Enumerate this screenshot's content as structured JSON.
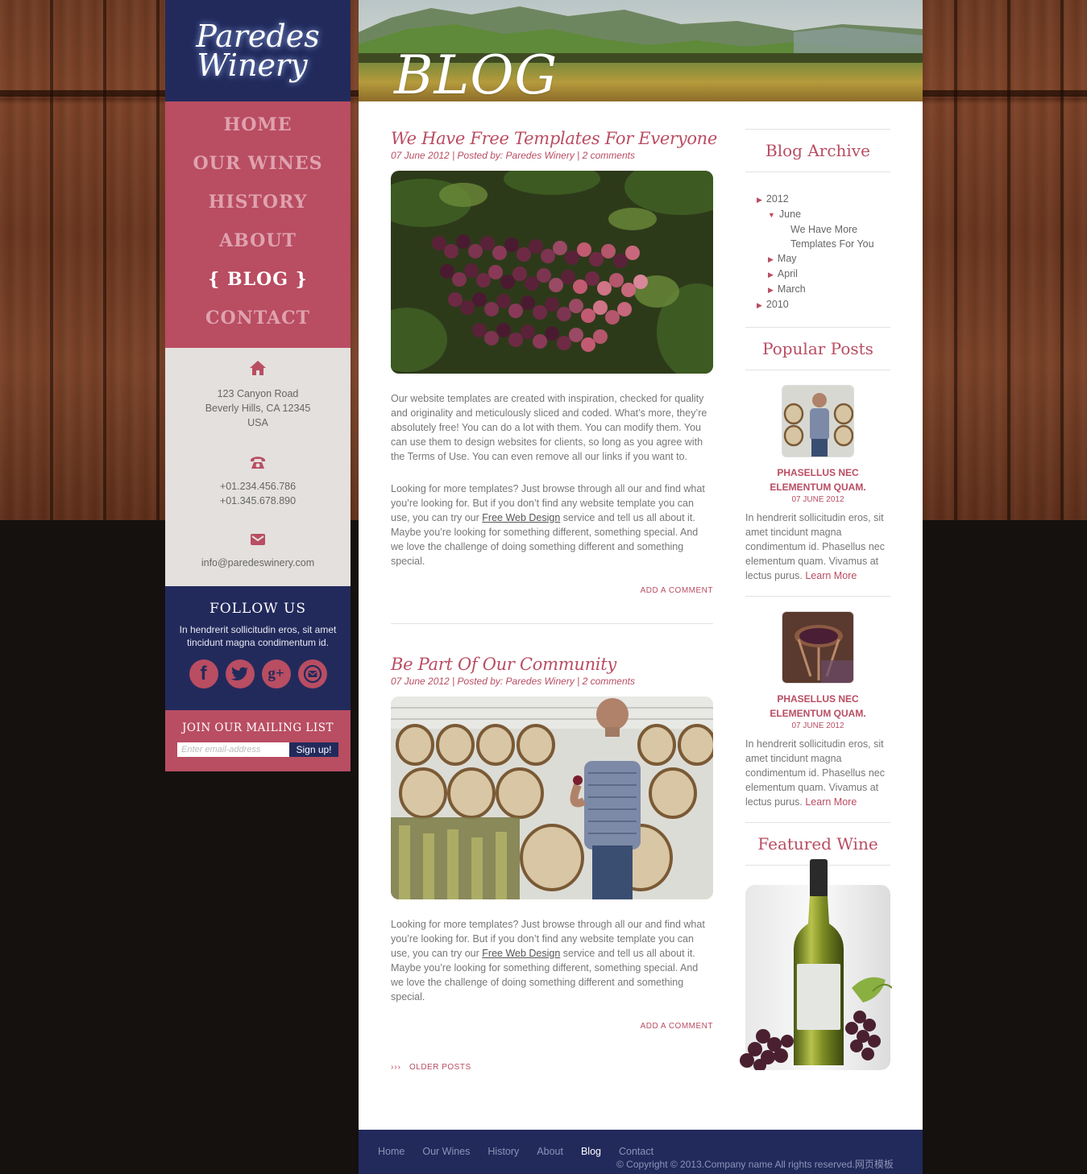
{
  "brand": {
    "line1": "Paredes",
    "line2": "Winery"
  },
  "nav": [
    {
      "label": "HOME"
    },
    {
      "label": "OUR WINES"
    },
    {
      "label": "HISTORY"
    },
    {
      "label": "ABOUT"
    },
    {
      "label": "{ BLOG }"
    },
    {
      "label": "CONTACT"
    }
  ],
  "contact": {
    "address_line1": "123 Canyon Road",
    "address_line2": "Beverly Hills, CA 12345",
    "address_line3": "USA",
    "phone1": "+01.234.456.786",
    "phone2": "+01.345.678.890",
    "email": "info@paredeswinery.com"
  },
  "follow": {
    "title": "FOLLOW US",
    "text": "In hendrerit sollicitudin eros, sit amet tincidunt magna condimentum id.",
    "icons": [
      "facebook-icon",
      "twitter-icon",
      "google-plus-icon",
      "mail-icon"
    ]
  },
  "mailing": {
    "title": "JOIN OUR MAILING LIST",
    "placeholder": "Enter email-address",
    "button": "Sign up!"
  },
  "banner": {
    "title": "BLOG"
  },
  "posts": [
    {
      "title": "We Have Free Templates For Everyone",
      "meta": "07 June 2012 | Posted by: Paredes Winery | 2 comments",
      "para1": "Our website templates are created with inspiration, checked for quality and originality and meticulously sliced and coded. What’s more, they’re absolutely free! You can do a lot with them. You can modify them. You can use them to design websites for clients, so long as you agree with the Terms of Use. You can even remove all our links if you want to.",
      "para2_a": "Looking for more templates? Just browse through all our and find what you’re looking for. But if you don’t find any website template you can use, you can try our ",
      "para2_link": "Free Web Design",
      "para2_b": " service and tell us all about it. Maybe you’re looking for something different, something special. And we love the challenge of doing something different and something special.",
      "add_comment": "ADD A COMMENT"
    },
    {
      "title": "Be Part Of Our Community",
      "meta": "07 June 2012 | Posted by: Paredes Winery | 2 comments",
      "para1_a": "Looking for more templates? Just browse through all our and find what you’re looking for. But if you don’t find any website template you can use, you can try our ",
      "para1_link": "Free Web Design",
      "para1_b": " service and tell us all about it. Maybe you’re looking for something different, something special. And we love the challenge of doing something different and something special.",
      "add_comment": "ADD A COMMENT"
    }
  ],
  "older_posts": {
    "arrows": "›››",
    "label": "OLDER POSTS"
  },
  "archive": {
    "title": "Blog Archive",
    "y2012": "2012",
    "june": "June",
    "june_post1": "We Have More",
    "june_post2": "Templates For You",
    "may": "May",
    "april": "April",
    "march": "March",
    "y2010": "2010"
  },
  "popular": {
    "title": "Popular Posts",
    "items": [
      {
        "title": "PHASELLUS NEC ELEMENTUM QUAM.",
        "date": "07 JUNE 2012",
        "text": "In hendrerit sollicitudin eros, sit amet tincidunt magna condimentum id. Phasellus nec elementum quam. Vivamus at lectus purus. ",
        "link": "Learn More"
      },
      {
        "title": "PHASELLUS NEC ELEMENTUM QUAM.",
        "date": "07 JUNE 2012",
        "text": "In hendrerit sollicitudin eros, sit amet tincidunt magna condimentum id. Phasellus nec elementum quam. Vivamus at lectus purus. ",
        "link": "Learn More"
      }
    ]
  },
  "featured": {
    "title": "Featured Wine"
  },
  "footer": {
    "links": [
      {
        "label": "Home"
      },
      {
        "label": "Our Wines"
      },
      {
        "label": "History"
      },
      {
        "label": "About"
      },
      {
        "label": "Blog"
      },
      {
        "label": "Contact"
      }
    ],
    "copyright": "© Copyright © 2013.Company name All rights reserved.网页模板"
  },
  "colors": {
    "navy": "#222a5c",
    "wine": "#b94d62",
    "nav_inactive": "#dfa2ae"
  }
}
